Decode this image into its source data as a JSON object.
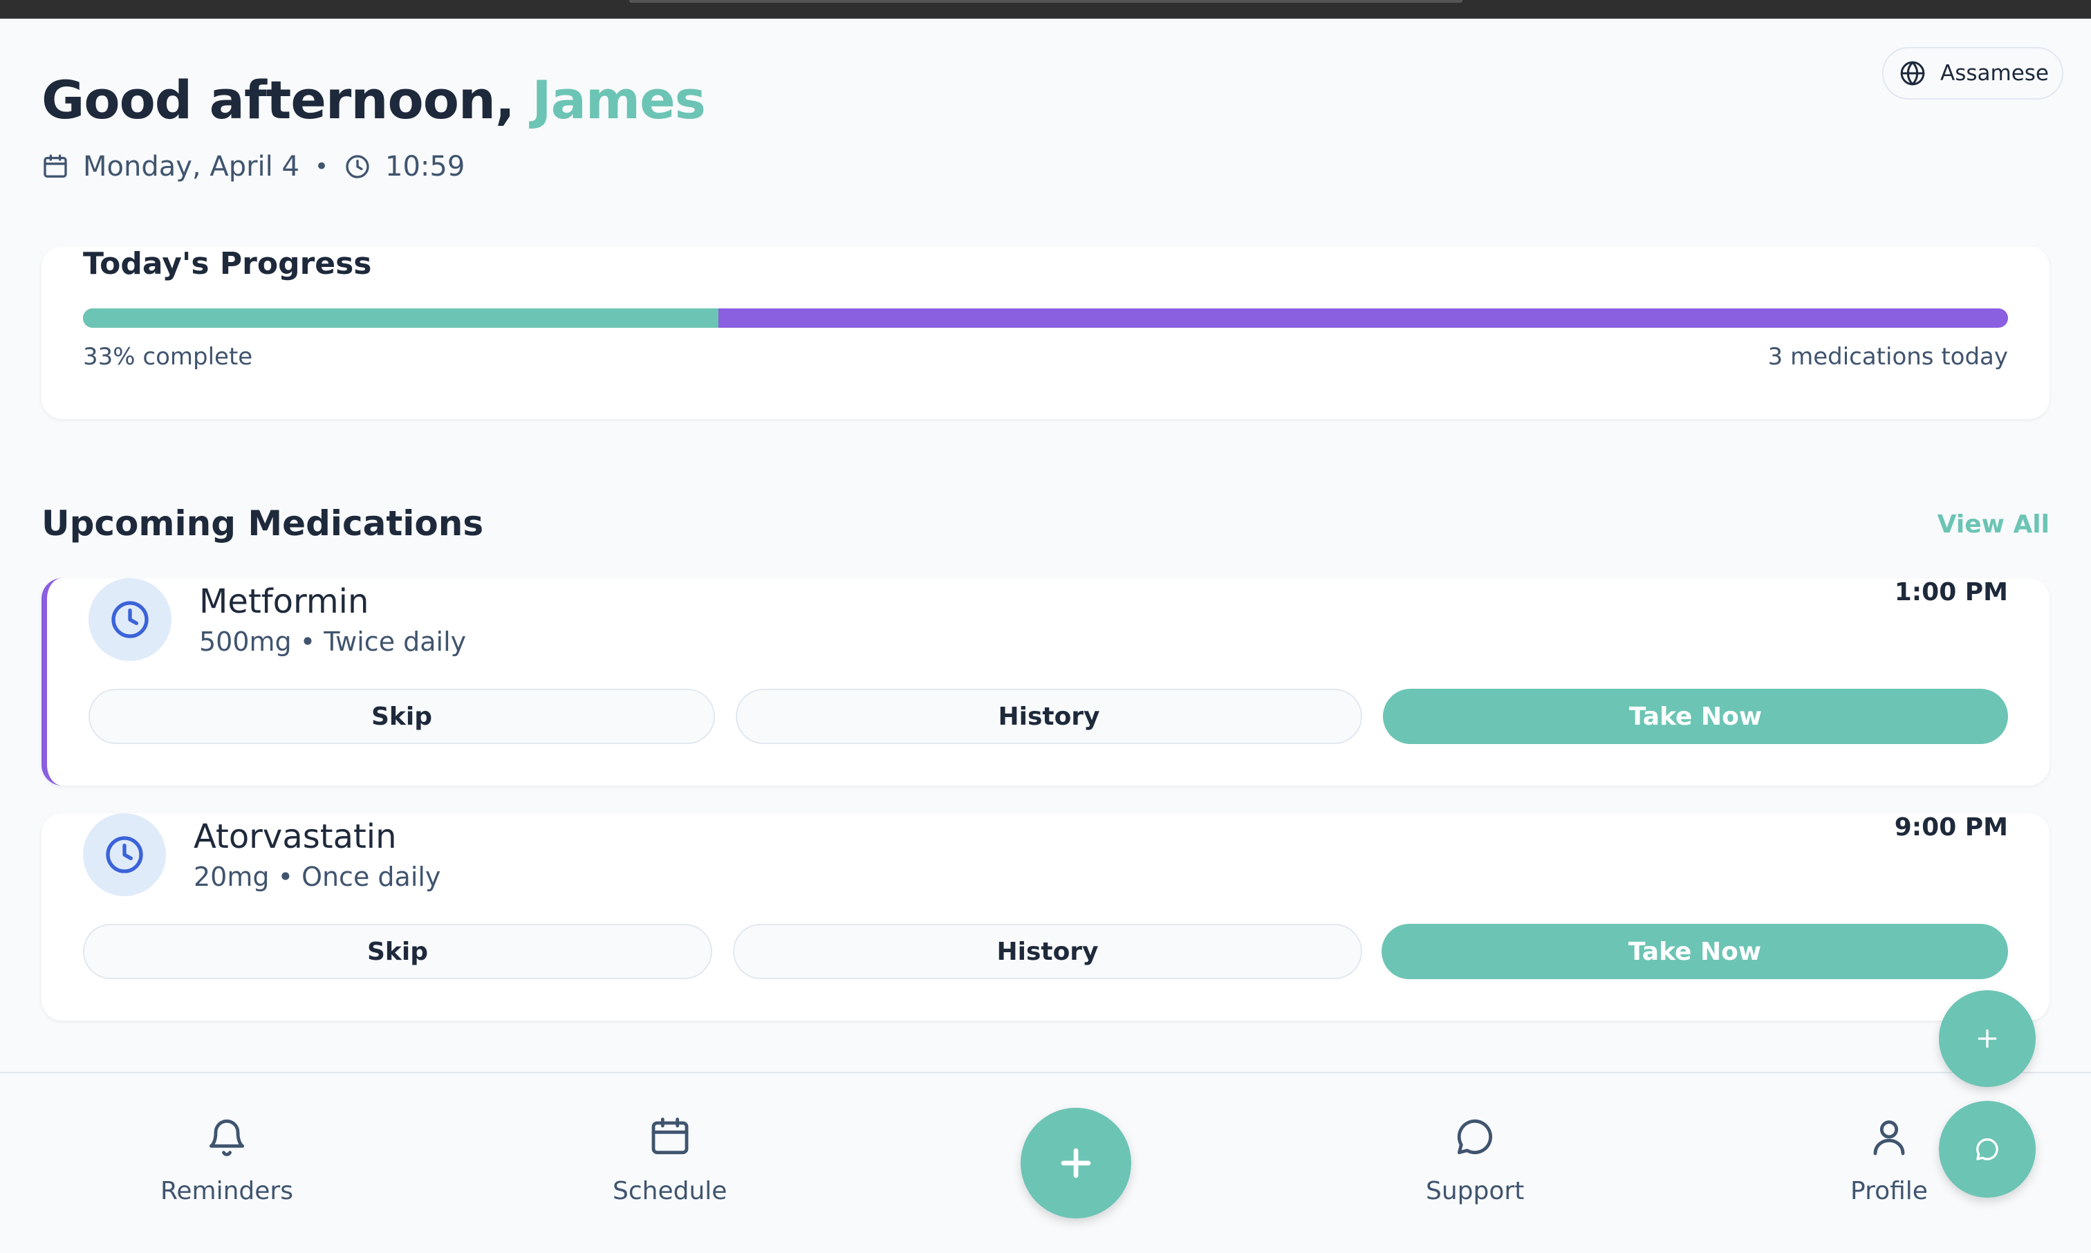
{
  "header": {
    "greeting_prefix": "Good afternoon, ",
    "user_name": "James",
    "date": "Monday, April 4",
    "separator": "•",
    "time": "10:59"
  },
  "language": {
    "label": "Assamese",
    "icon": "globe-icon"
  },
  "progress": {
    "title": "Today's Progress",
    "percent": 33,
    "percent_label": "33% complete",
    "count_label": "3 medications today",
    "colors": {
      "done": "#6cc4b4",
      "remaining": "#8a5fe0"
    }
  },
  "upcoming": {
    "title": "Upcoming Medications",
    "view_all": "View All",
    "items": [
      {
        "name": "Metformin",
        "dose": "500mg • Twice daily",
        "time": "1:00 PM",
        "icon": "clock-icon",
        "skip_label": "Skip",
        "history_label": "History",
        "take_label": "Take Now"
      },
      {
        "name": "Atorvastatin",
        "dose": "20mg • Once daily",
        "time": "9:00 PM",
        "icon": "clock-icon",
        "skip_label": "Skip",
        "history_label": "History",
        "take_label": "Take Now"
      }
    ]
  },
  "nav": {
    "items": [
      {
        "label": "Reminders",
        "icon": "bell-icon"
      },
      {
        "label": "Schedule",
        "icon": "calendar-icon"
      },
      {
        "label": "Support",
        "icon": "chat-bubble-icon"
      },
      {
        "label": "Profile",
        "icon": "user-icon"
      }
    ],
    "center_icon": "plus-icon"
  },
  "floating": {
    "add_icon": "plus-icon",
    "chat_icon": "chat-bubble-icon"
  },
  "colors": {
    "accent": "#6cc4b4",
    "purple": "#8a5fe0",
    "text": "#1e293b",
    "muted": "#40546e"
  }
}
